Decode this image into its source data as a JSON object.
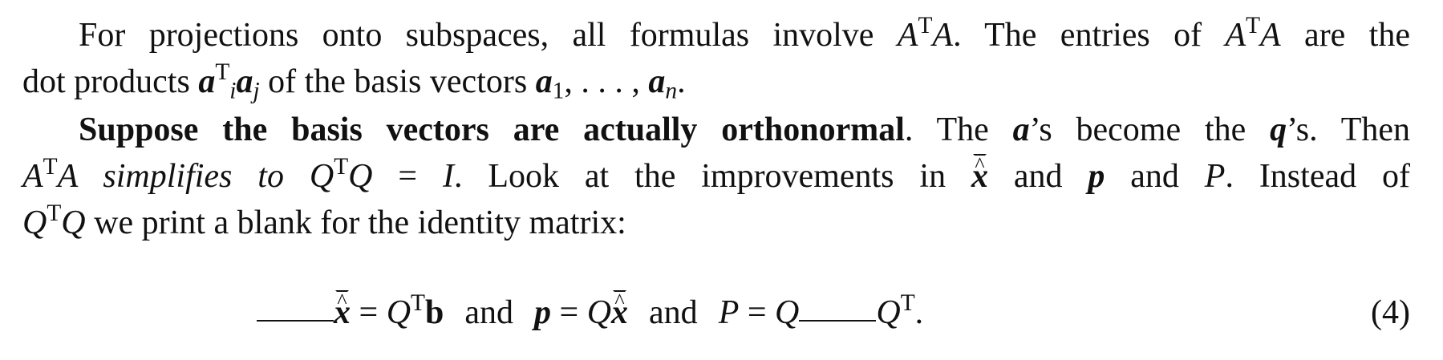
{
  "paragraph1": {
    "line1_a": "For projections onto subspaces, all formulas involve ",
    "line1_b": ". The entries of ",
    "line1_c": " are the",
    "line2_a": "dot products ",
    "line2_b": " of the basis vectors ",
    "line2_c": ", . . . , ",
    "line2_d": "."
  },
  "paragraph2": {
    "bold_lead": "Suppose the basis vectors are actually orthonormal",
    "line3_rest": ". The ",
    "line3_b": "’s become the ",
    "line3_c": "’s. Then",
    "line4_a": " simplifies to ",
    "line4_b": " = ",
    "line4_c": ". Look at the improvements in ",
    "line4_d": " and ",
    "line4_e": " and ",
    "line4_f": ". Instead of",
    "line5_a": " we print a blank for the identity matrix:"
  },
  "symbols": {
    "A": "A",
    "T": "T",
    "Q": "Q",
    "I": "I",
    "P": "P",
    "a": "a",
    "q": "q",
    "x": "x",
    "p": "p",
    "b": "b",
    "i": "i",
    "j": "j",
    "n": "n",
    "one": "1",
    "hat": "^"
  },
  "equation": {
    "eq1": " = ",
    "and1": "and",
    "eq2": " = ",
    "and2": "and",
    "eq3": " = ",
    "period": ".",
    "number": "(4)"
  }
}
